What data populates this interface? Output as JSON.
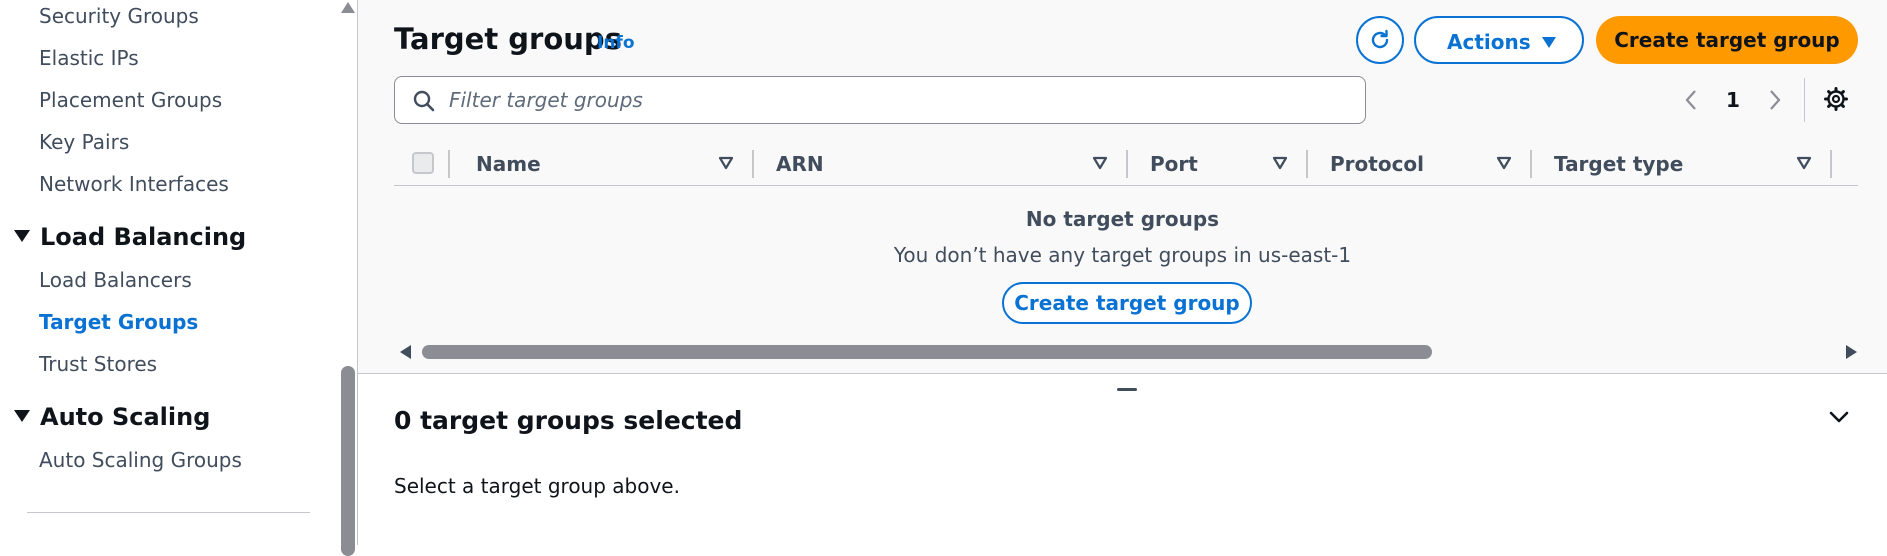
{
  "sidebar": {
    "items_top": [
      "Security Groups",
      "Elastic IPs",
      "Placement Groups",
      "Key Pairs",
      "Network Interfaces"
    ],
    "sections": [
      {
        "title": "Load Balancing",
        "items": [
          "Load Balancers",
          "Target Groups",
          "Trust Stores"
        ],
        "active": "Target Groups"
      },
      {
        "title": "Auto Scaling",
        "items": [
          "Auto Scaling Groups"
        ]
      }
    ]
  },
  "header": {
    "title": "Target groups",
    "info_label": "Info",
    "actions_label": "Actions",
    "create_label": "Create target group"
  },
  "search": {
    "placeholder": "Filter target groups"
  },
  "pagination": {
    "current_page": "1"
  },
  "table": {
    "columns": [
      "Name",
      "ARN",
      "Port",
      "Protocol",
      "Target type"
    ],
    "empty_title": "No target groups",
    "empty_description": "You don’t have any target groups in us-east-1",
    "empty_action_label": "Create target group"
  },
  "split_panel": {
    "title": "0 target groups selected",
    "body": "Select a target group above."
  },
  "colors": {
    "accent": "#0972d3",
    "primary_button": "#ff9900",
    "text": "#0f141a",
    "muted": "#414d5c",
    "border": "#c6c6cd"
  },
  "icons": [
    "refresh-icon",
    "caret-down-icon",
    "search-icon",
    "chevron-left-icon",
    "chevron-right-icon",
    "settings-gear-icon",
    "sort-icon",
    "chevron-down-icon"
  ]
}
